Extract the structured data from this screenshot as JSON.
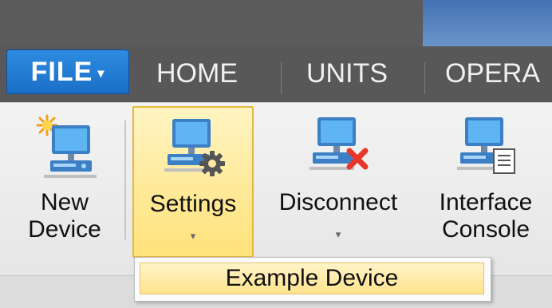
{
  "menu": {
    "file_label": "FILE",
    "file_caret": "▾",
    "tabs": [
      "HOME",
      "UNITS",
      "OPERA"
    ]
  },
  "ribbon": {
    "new_device": {
      "line1": "New",
      "line2": "Device"
    },
    "settings": {
      "label": "Settings",
      "caret": "▾"
    },
    "disconnect": {
      "label": "Disconnect",
      "caret": "▾"
    },
    "interface_console": {
      "line1": "Interface",
      "line2": "Console"
    }
  },
  "dropdown": {
    "items": [
      "Example Device"
    ]
  },
  "colors": {
    "file_tab": "#1f78d1",
    "highlight": "#ffe27a",
    "highlight_border": "#e7b83f",
    "tab_bar": "#585858"
  },
  "icons": {
    "new_device": "computer-with-spark-icon",
    "settings": "computer-with-gear-icon",
    "disconnect": "computer-with-red-x-icon",
    "interface_console": "computer-with-document-icon"
  }
}
